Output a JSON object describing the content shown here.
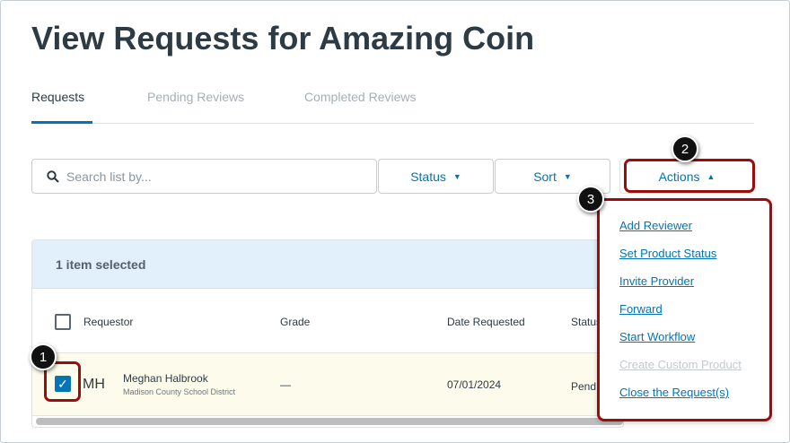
{
  "page_title": "View Requests for Amazing Coin",
  "tabs": [
    {
      "label": "Requests"
    },
    {
      "label": "Pending Reviews"
    },
    {
      "label": "Completed Reviews"
    }
  ],
  "search": {
    "placeholder": "Search list by..."
  },
  "filters": {
    "status": "Status",
    "sort": "Sort",
    "actions": "Actions"
  },
  "selection": {
    "text": "1 item selected"
  },
  "table": {
    "headers": [
      "Requestor",
      "Grade",
      "Date Requested",
      "Status"
    ],
    "rows": [
      {
        "initials": "MH",
        "name": "Meghan Halbrook",
        "org": "Madison County School District",
        "grade": "—",
        "date": "07/01/2024",
        "status": "Pend"
      }
    ]
  },
  "actions_menu": [
    {
      "label": "Add Reviewer"
    },
    {
      "label": "Set Product Status"
    },
    {
      "label": "Invite Provider"
    },
    {
      "label": "Forward"
    },
    {
      "label": "Start Workflow"
    },
    {
      "label": "Create Custom Product",
      "disabled": true
    },
    {
      "label": "Close the Request(s)"
    }
  ],
  "callouts": [
    "1",
    "2",
    "3"
  ]
}
